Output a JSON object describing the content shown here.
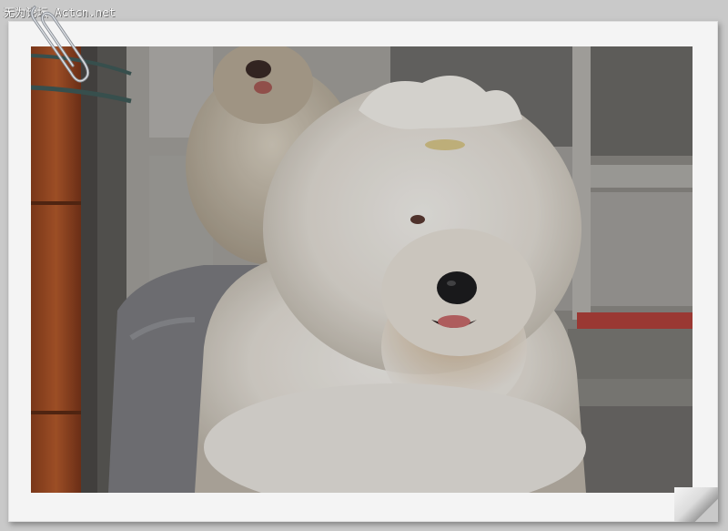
{
  "watermark": {
    "text": "无为论坛 Actcn.net"
  },
  "photo": {
    "subject": "old-english-sheepdog",
    "palette": {
      "fur": "#e9e6e0",
      "fur_shadow": "#c9c2b6",
      "grey_coat": "#7d7e82",
      "post": "#a8542a",
      "door": "#9c9a96",
      "nose": "#1d1d1f",
      "tongue": "#c76a6a"
    }
  },
  "icons": {
    "paperclip": "paperclip-icon"
  }
}
